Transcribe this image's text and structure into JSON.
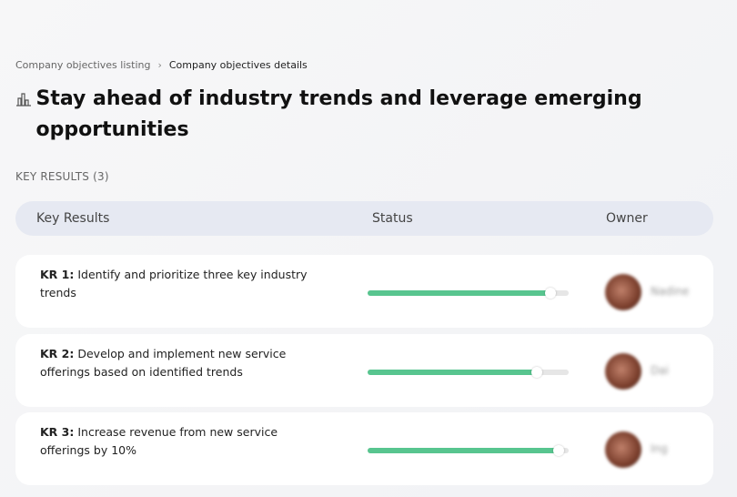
{
  "breadcrumb": {
    "previous": "Company objectives listing",
    "separator": "›",
    "current": "Company objectives details"
  },
  "objective": {
    "icon": "bar-chart-building-icon",
    "title": "Stay ahead of industry trends and leverage emerging opportunities"
  },
  "key_results_label": "KEY RESULTS (3)",
  "table": {
    "headers": {
      "key_results": "Key Results",
      "status": "Status",
      "owner": "Owner"
    }
  },
  "colors": {
    "progress": "#58c58f",
    "header_bg": "#e6e9f2"
  },
  "rows": [
    {
      "id": "KR 1:",
      "text": "Identify and prioritize three key industry trends",
      "progress": 91,
      "owner": "Nadine"
    },
    {
      "id": "KR 2:",
      "text": "Develop and implement new service offerings based on identified trends",
      "progress": 84,
      "owner": "Dai"
    },
    {
      "id": "KR 3:",
      "text": "Increase revenue from new service offerings by 10%",
      "progress": 95,
      "owner": "Ing"
    }
  ]
}
